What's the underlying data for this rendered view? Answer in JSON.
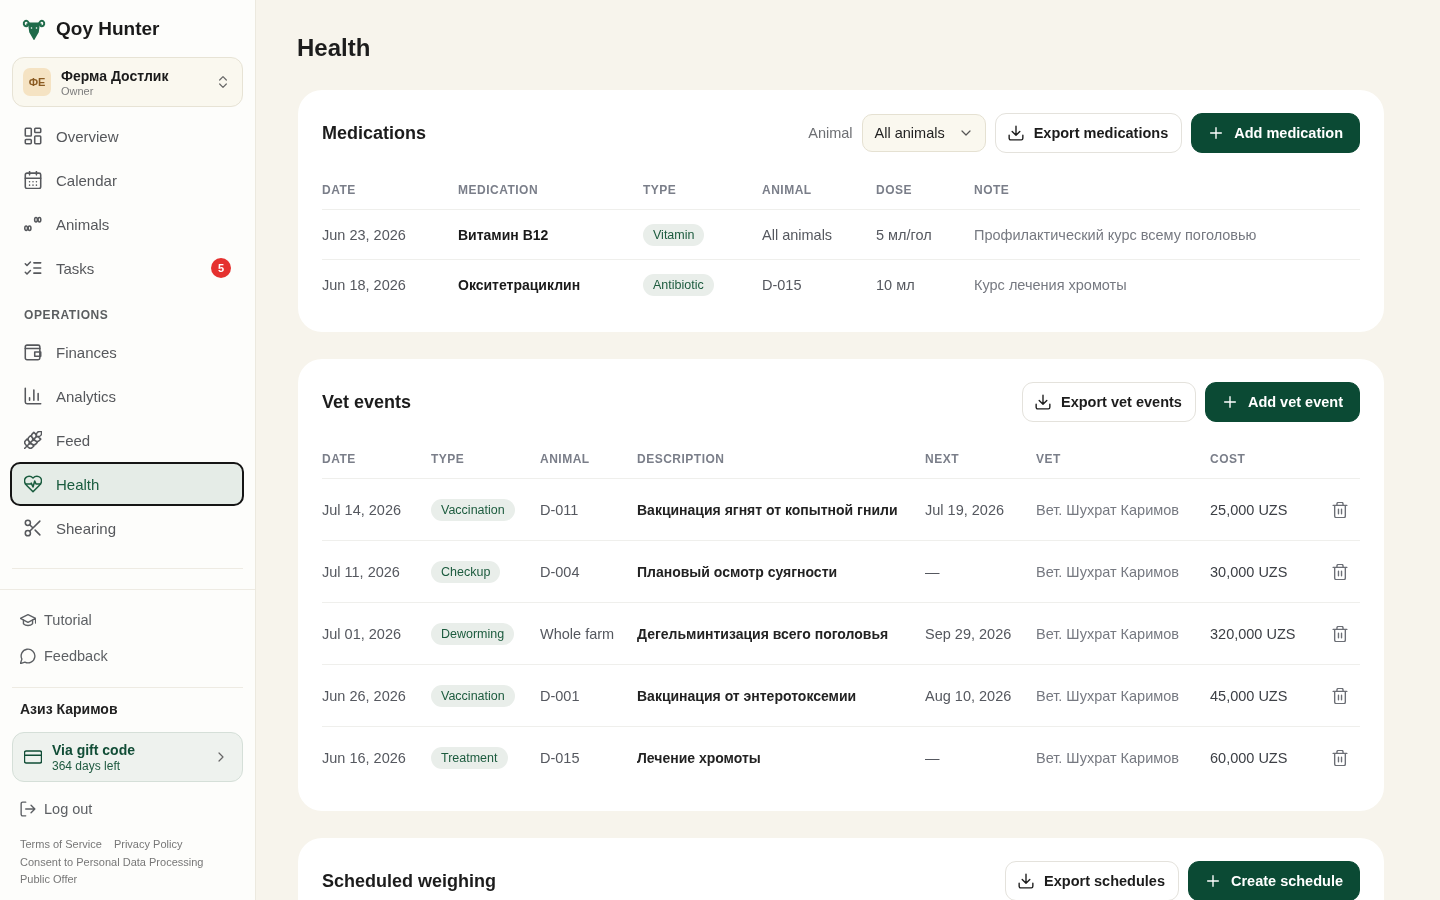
{
  "sidebar": {
    "brand": "Qoy Hunter",
    "farm": {
      "initials": "ФЕ",
      "name": "Ферма Достлик",
      "role": "Owner"
    },
    "nav_sections": [
      {
        "items": [
          {
            "label": "Overview",
            "selected": false
          },
          {
            "label": "Calendar",
            "selected": false
          },
          {
            "label": "Animals",
            "selected": false
          },
          {
            "label": "Tasks",
            "selected": false,
            "badge": "5"
          }
        ]
      },
      {
        "heading": "OPERATIONS",
        "items": [
          {
            "label": "Finances",
            "selected": false
          },
          {
            "label": "Analytics",
            "selected": false
          },
          {
            "label": "Feed",
            "selected": false
          },
          {
            "label": "Health",
            "selected": true
          },
          {
            "label": "Shearing",
            "selected": false
          }
        ]
      }
    ],
    "help_links": [
      "Tutorial",
      "Feedback"
    ],
    "user_name": "Азиз Каримов",
    "subscription": {
      "title": "Via gift code",
      "subtitle": "364 days left"
    },
    "logout": "Log out",
    "footer_links": [
      "Terms of Service",
      "Privacy Policy",
      "Consent to Personal Data Processing",
      "Public Offer"
    ]
  },
  "page": {
    "title": "Health"
  },
  "medications": {
    "title": "Medications",
    "filter": {
      "label": "Animal",
      "value": "All animals"
    },
    "buttons": [
      {
        "label": "Export medications",
        "kind": "secondary"
      },
      {
        "label": "Add medication",
        "kind": "primary"
      }
    ],
    "table": {
      "columns": [
        "DATE",
        "MEDICATION",
        "TYPE",
        "ANIMAL",
        "DOSE",
        "NOTE"
      ],
      "rows": [
        {
          "date": "Jun 23, 2026",
          "medication": "Витамин B12",
          "type": "Vitamin",
          "animal": "All animals",
          "dose": "5 мл/гол",
          "note": "Профилактический курс всему поголовью"
        },
        {
          "date": "Jun 18, 2026",
          "medication": "Окситетрациклин",
          "type": "Antibiotic",
          "animal": "D-015",
          "dose": "10 мл",
          "note": "Курс лечения хромоты"
        }
      ]
    }
  },
  "vet_events": {
    "title": "Vet events",
    "buttons": [
      {
        "label": "Export vet events",
        "kind": "secondary"
      },
      {
        "label": "Add vet event",
        "kind": "primary"
      }
    ],
    "table": {
      "columns": [
        "DATE",
        "TYPE",
        "ANIMAL",
        "DESCRIPTION",
        "NEXT",
        "VET",
        "COST"
      ],
      "rows": [
        {
          "date": "Jul 14, 2026",
          "type": "Vaccination",
          "animal": "D-011",
          "description": "Вакцинация ягнят от копытной гнили",
          "next": "Jul 19, 2026",
          "vet": "Вет. Шухрат Каримов",
          "cost": "25,000 UZS"
        },
        {
          "date": "Jul 11, 2026",
          "type": "Checkup",
          "animal": "D-004",
          "description": "Плановый осмотр суягности",
          "next": "—",
          "vet": "Вет. Шухрат Каримов",
          "cost": "30,000 UZS"
        },
        {
          "date": "Jul 01, 2026",
          "type": "Deworming",
          "animal": "Whole farm",
          "description": "Дегельминтизация всего поголовья",
          "next": "Sep 29, 2026",
          "vet": "Вет. Шухрат Каримов",
          "cost": "320,000 UZS"
        },
        {
          "date": "Jun 26, 2026",
          "type": "Vaccination",
          "animal": "D-001",
          "description": "Вакцинация от энтеротоксемии",
          "next": "Aug 10, 2026",
          "vet": "Вет. Шухрат Каримов",
          "cost": "45,000 UZS"
        },
        {
          "date": "Jun 16, 2026",
          "type": "Treatment",
          "animal": "D-015",
          "description": "Лечение хромоты",
          "next": "—",
          "vet": "Вет. Шухрат Каримов",
          "cost": "60,000 UZS"
        }
      ]
    }
  },
  "scheduled_weighing": {
    "title": "Scheduled weighing",
    "buttons": [
      {
        "label": "Export schedules",
        "kind": "secondary"
      },
      {
        "label": "Create schedule",
        "kind": "primary"
      }
    ]
  }
}
